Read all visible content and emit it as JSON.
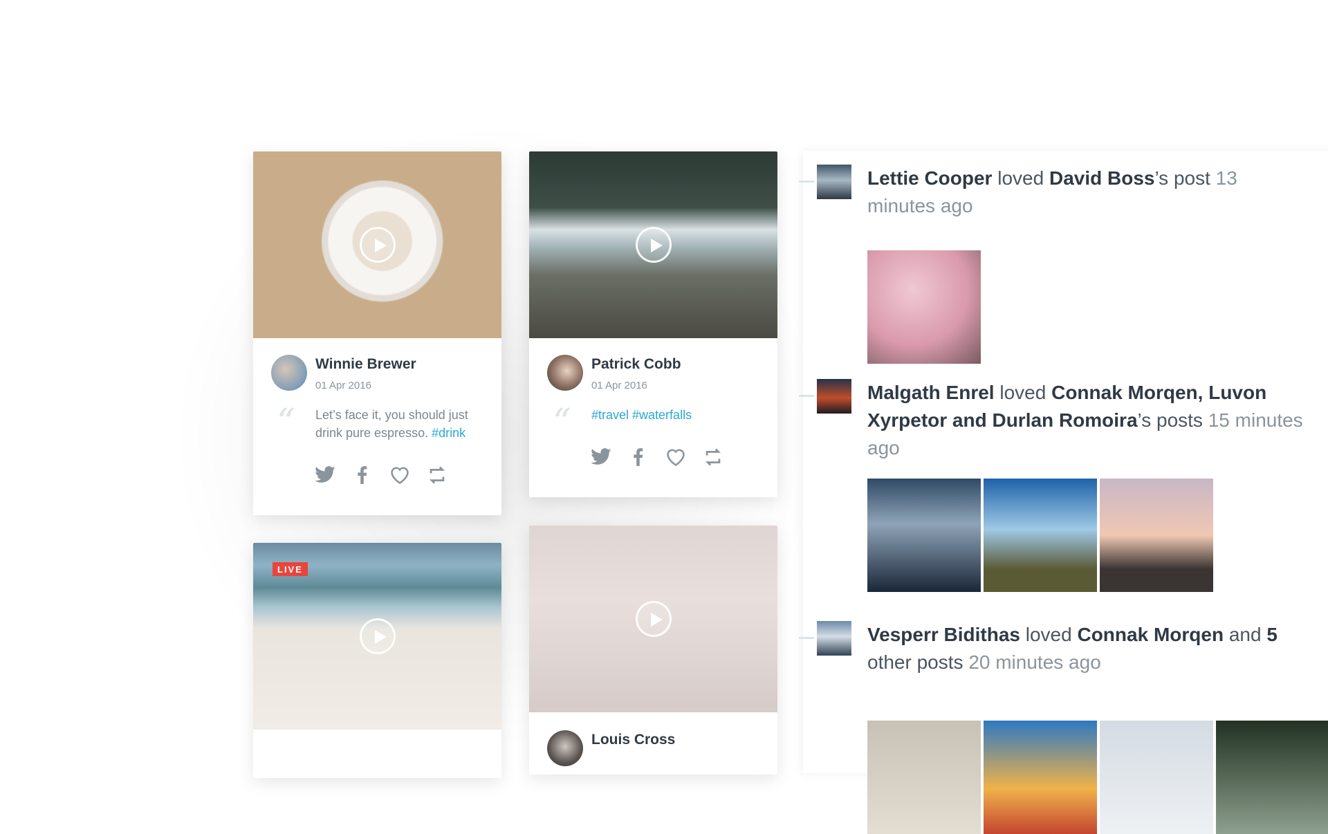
{
  "cards": [
    {
      "name": "Winnie Brewer",
      "date": "01 Apr 2016",
      "text": "Let’s face it, you should just drink pure espresso.",
      "tag": "#drink",
      "media_icon": "play-icon"
    },
    {
      "name": "Patrick Cobb",
      "date": "01 Apr 2016",
      "tags": "#travel #waterfalls",
      "media_icon": "play-icon"
    },
    {
      "badge": "LIVE",
      "media_icon": "play-icon"
    },
    {
      "name": "Louis Cross",
      "media_icon": "play-icon"
    }
  ],
  "actions": [
    "twitter-icon",
    "facebook-icon",
    "heart-icon",
    "retweet-icon"
  ],
  "feed": [
    {
      "actor": "Lettie Cooper",
      "verb": "loved",
      "target": "David Boss",
      "suffix": "’s post",
      "time": "13 minutes ago"
    },
    {
      "actor": "Malgath Enrel",
      "verb": "loved",
      "target": "Connak Morqen, Luvon Xyrpetor and Durlan Romoira",
      "suffix": "’s posts",
      "time": "15 minutes ago"
    },
    {
      "actor": "Vesperr Bidithas",
      "verb": "loved",
      "target": "Connak Morqen",
      "mid": "and",
      "count": "5",
      "suffix": "other posts",
      "time": "20 minutes ago"
    }
  ],
  "colors": {
    "accent": "#2aa8d4",
    "live": "#e8453c",
    "text": "#2f3a45",
    "muted": "#8a949c"
  }
}
